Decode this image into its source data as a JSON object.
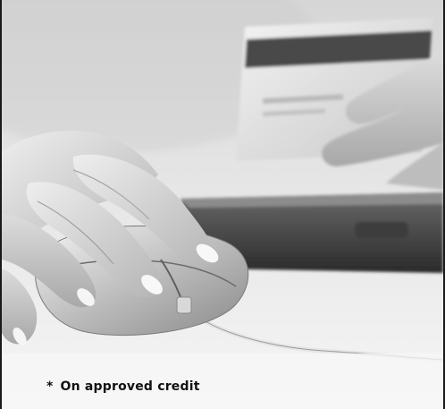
{
  "footnote": {
    "marker": "*",
    "text": "On approved credit"
  },
  "photo": {
    "subject": [
      "hand-on-mouse",
      "hand-holding-credit-card",
      "laptop"
    ],
    "tone": "grayscale"
  }
}
